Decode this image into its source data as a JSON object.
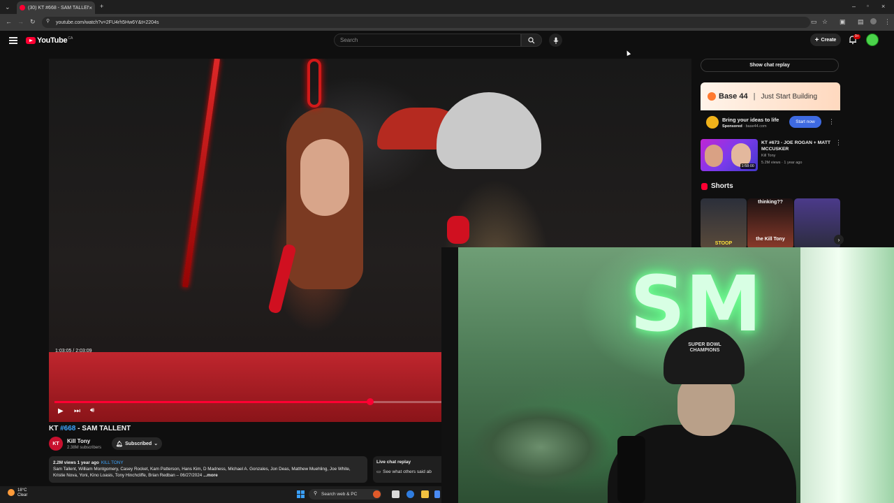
{
  "browser": {
    "tab_title": "(30) KT #668 - SAM TALLENT -",
    "tab_close": "×",
    "new_tab": "+",
    "url": "youtube.com/watch?v=2FU4rh5Hw6Y&t=2204s"
  },
  "header": {
    "logo_text": "YouTube",
    "logo_country": "CA",
    "search_placeholder": "Search",
    "create_label": "Create",
    "notif_badge": "9+"
  },
  "player": {
    "time": "1:03:05 / 2:03:09",
    "progress_fraction": 0.5
  },
  "video": {
    "title_tag": "#668",
    "title_prefix": "KT",
    "title_suffix": "- SAM TALLENT",
    "channel_avatar": "KT",
    "channel_name": "Kill Tony",
    "subscribers": "2.38M subscribers",
    "subscribed_label": "Subscribed",
    "views_meta": "2.2M views  1 year ago",
    "channel_tag": "KILL TONY",
    "description": "Sam Tallent, William Montgomery, Casey Rocket, Kam Patterson, Hans Kim, D Madness, Michael A. Gonzales, Jon Deas, Matthew Muehling, Joe White, Kristie Nova, Yoni, Kino Loasis, Tony Hinchcliffe, Brian Redban – 06/27/2024",
    "more_label": "...more",
    "live_chat_title": "Live chat replay",
    "live_chat_text": "See what others said ab"
  },
  "sidebar": {
    "show_chat_replay": "Show chat replay",
    "ad": {
      "brand": "Base 44",
      "separator": "|",
      "tagline": "Just Start Building",
      "title": "Bring your ideas to life",
      "sponsored": "Sponsored",
      "domain": "· base44.com",
      "cta": "Start now"
    },
    "rec": {
      "title": "KT #673 - JOE ROGAN + MATT MCCUSKER",
      "channel": "Kill Tony",
      "meta": "5.2M views · 1 year ago",
      "duration": "1:58:00"
    },
    "shorts_label": "Shorts",
    "shorts": [
      {
        "caption": "STOOP"
      },
      {
        "caption": "thinking??"
      },
      {
        "caption": "the Kill Tony"
      }
    ]
  },
  "webcam": {
    "neon_text": "SM",
    "cap_text": "SUPER BOWL CHAMPIONS"
  },
  "taskbar": {
    "temp": "18°C",
    "condition": "Clear",
    "search": "Search web & PC"
  },
  "colors": {
    "youtube_red": "#ff0033",
    "link_blue": "#3ea6ff",
    "cta_blue": "#3e6ae1"
  }
}
